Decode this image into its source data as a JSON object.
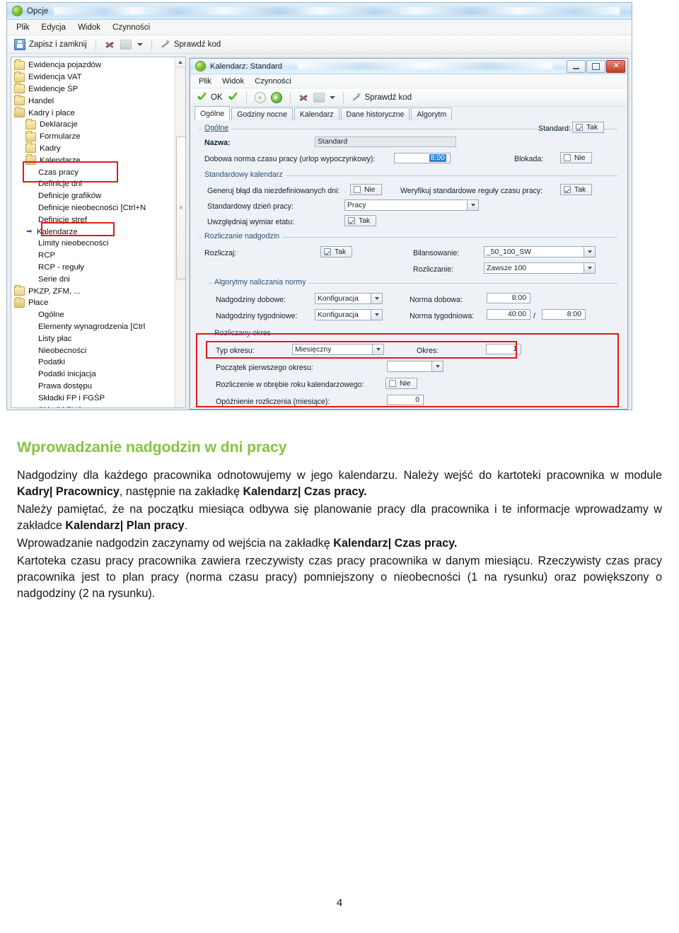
{
  "outer_window": {
    "title": "Opcje",
    "icon": "app-green-icon",
    "menu": [
      "Plik",
      "Edycja",
      "Widok",
      "Czynności"
    ],
    "toolbar": {
      "save_label": "Zapisz i zamknij",
      "check_code_label": "Sprawdź kod"
    }
  },
  "tree": {
    "items": [
      {
        "label": "Ewidencja pojazdów",
        "icon": "folder-icon",
        "indent": 1
      },
      {
        "label": "Ewidencja VAT",
        "icon": "folder-icon",
        "indent": 1
      },
      {
        "label": "Ewidencje ŚP",
        "icon": "folder-icon",
        "indent": 1
      },
      {
        "label": "Handel",
        "icon": "folder-icon",
        "indent": 1
      },
      {
        "label": "Kadry i płace",
        "icon": "folder-open-icon",
        "indent": 1
      },
      {
        "label": "Deklaracje",
        "icon": "folder-icon",
        "indent": 2
      },
      {
        "label": "Formularze",
        "icon": "folder-icon",
        "indent": 2
      },
      {
        "label": "Kadry",
        "icon": "folder-icon",
        "indent": 2
      },
      {
        "label": "Kalendarze",
        "icon": "folder-open-icon",
        "indent": 2
      },
      {
        "label": "Czas pracy",
        "icon": "none",
        "indent": 3
      },
      {
        "label": "Definicje dni",
        "icon": "none",
        "indent": 3
      },
      {
        "label": "Definicje grafików",
        "icon": "none",
        "indent": 3
      },
      {
        "label": "Definicje nieobecności [Ctrl+N",
        "icon": "none",
        "indent": 3
      },
      {
        "label": "Definicje stref",
        "icon": "none",
        "indent": 3
      },
      {
        "label": "Kalendarze",
        "icon": "arrow-right-icon",
        "indent": 3
      },
      {
        "label": "Limity nieobecności",
        "icon": "none",
        "indent": 3
      },
      {
        "label": "RCP",
        "icon": "none",
        "indent": 3
      },
      {
        "label": "RCP - reguły",
        "icon": "none",
        "indent": 3
      },
      {
        "label": "Serie dni",
        "icon": "none",
        "indent": 3
      },
      {
        "label": "PKZP, ZFM, ...",
        "icon": "folder-icon",
        "indent": 1
      },
      {
        "label": "Płace",
        "icon": "folder-open-icon",
        "indent": 1
      },
      {
        "label": "Ogólne",
        "icon": "none",
        "indent": 3
      },
      {
        "label": "Elementy wynagrodzenia [Ctrl",
        "icon": "none",
        "indent": 3
      },
      {
        "label": "Listy płac",
        "icon": "none",
        "indent": 3
      },
      {
        "label": "Nieobecności",
        "icon": "none",
        "indent": 3
      },
      {
        "label": "Podatki",
        "icon": "none",
        "indent": 3
      },
      {
        "label": "Podatki inicjacja",
        "icon": "none",
        "indent": 3
      },
      {
        "label": "Prawa dostępu",
        "icon": "none",
        "indent": 3
      },
      {
        "label": "Składki FP i FGŚP",
        "icon": "none",
        "indent": 3
      },
      {
        "label": "Składki ZUS",
        "icon": "none",
        "indent": 3
      }
    ]
  },
  "inner_window": {
    "title": "Kalendarz: Standard",
    "menu": [
      "Plik",
      "Widok",
      "Czynności"
    ],
    "toolbar": {
      "ok_label": "OK",
      "check_code_label": "Sprawdź kod"
    },
    "window_buttons": {
      "minimize": "–",
      "maximize": "□",
      "close": "✕"
    },
    "tabs": [
      {
        "label": "Ogólne",
        "active": true
      },
      {
        "label": "Godziny nocne",
        "active": false
      },
      {
        "label": "Kalendarz",
        "active": false
      },
      {
        "label": "Dane historyczne",
        "active": false
      },
      {
        "label": "Algorytm",
        "active": false
      }
    ],
    "form": {
      "group_ogolne": "Ogólne",
      "standard_label": "Standard:",
      "standard_value": "Tak",
      "nazwa_label": "Nazwa:",
      "nazwa_value": "Standard",
      "dobowa_norma_label": "Dobowa norma czasu pracy (urlop wypoczynkowy):",
      "dobowa_norma_value": "8:00",
      "blokada_label": "Blokada:",
      "blokada_value": "Nie",
      "group_standardowy_kalendarz": "Standardowy kalendarz",
      "generuj_blad_label": "Generuj błąd dla niezdefiniowanych dni:",
      "generuj_blad_value": "Nie",
      "weryfikuj_label": "Weryfikuj standardowe reguły czasu pracy:",
      "weryfikuj_value": "Tak",
      "standardowy_dzien_label": "Standardowy dzień pracy:",
      "standardowy_dzien_value": "Pracy",
      "uwzgledniaj_label": "Uwzględniaj wymiar etatu:",
      "uwzgledniaj_value": "Tak",
      "group_rozliczanie_nadgodzin": "Rozliczanie nadgodzin",
      "rozliczaj_label": "Rozliczaj:",
      "rozliczaj_value": "Tak",
      "bilansowanie_label": "Bilansowanie:",
      "bilansowanie_value": "_50_100_SW",
      "rozliczanie_label": "Rozliczanie:",
      "rozliczanie_value": "Zawsze 100",
      "group_algorytmy": "Algorytmy naliczania normy",
      "nadgodziny_dobowe_label": "Nadgodziny dobowe:",
      "nadgodziny_dobowe_value": "Konfiguracja",
      "norma_dobowa_label": "Norma dobowa:",
      "norma_dobowa_value": "8:00",
      "nadgodziny_tygodniowe_label": "Nadgodziny tygodniowe:",
      "nadgodziny_tygodniowe_value": "Konfiguracja",
      "norma_tygodniowa_label": "Norma tygodniowa:",
      "norma_tygodniowa_value": "40:00",
      "norma_tygodniowa_sep": "/",
      "norma_tygodniowa_value2": "8:00",
      "group_rozliczany_okres": "Rozliczany okres",
      "typ_okresu_label": "Typ okresu:",
      "typ_okresu_value": "Miesięczny",
      "okres_label": "Okres:",
      "okres_value": "1",
      "poczatek_label": "Początek pierwszego okresu:",
      "poczatek_value": "",
      "rozliczenie_rok_label": "Rozliczenie w obrębie roku kalendarzowego:",
      "rozliczenie_rok_value": "Nie",
      "opoznienie_label": "Opóźnienie rozliczenia (miesiące):",
      "opoznienie_value": "0"
    }
  },
  "document": {
    "heading": "Wprowadzanie nadgodzin w dni pracy",
    "paragraph1_a": "Nadgodziny dla każdego pracownika odnotowujemy w jego kalendarzu. Należy wejść do kartoteki pracownika w module ",
    "paragraph1_b1": "Kadry| Pracownicy",
    "paragraph1_c": ", następnie na zakładkę ",
    "paragraph1_b2": "Kalendarz| Czas pracy.",
    "paragraph2_a": "Należy pamiętać, że na początku miesiąca odbywa się planowanie pracy dla pracownika i te informacje wprowadzamy w zakładce ",
    "paragraph2_b1": "Kalendarz| Plan pracy",
    "paragraph2_c": ".",
    "paragraph3_a": "Wprowadzanie nadgodzin zaczynamy od wejścia na zakładkę ",
    "paragraph3_b1": "Kalendarz| Czas pracy.",
    "paragraph4": "Kartoteka czasu pracy pracownika zawiera rzeczywisty czas pracy pracownika w danym miesiącu. Rzeczywisty czas pracy pracownika jest to plan pracy (norma czasu pracy) pomniejszony o nieobecności (1 na rysunku) oraz powiększony o nadgodziny (2 na rysunku).",
    "page_number": "4"
  },
  "colors": {
    "heading_green": "#86c440",
    "highlight_red": "#e01b18",
    "selection_blue": "#2f7fd8"
  }
}
